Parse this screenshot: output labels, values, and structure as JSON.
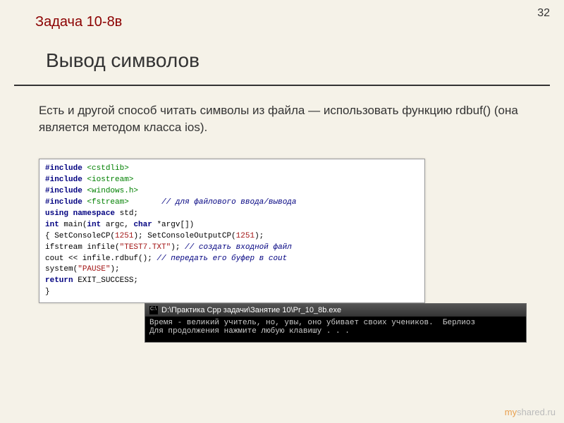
{
  "page_number": "32",
  "task_label": "Задача 10-8в",
  "title": "Вывод символов",
  "description": "Есть и другой способ читать символы из файла — использовать функцию rdbuf() (она является методом класса ios).",
  "code": {
    "inc1": "#include",
    "inc1h": "<cstdlib>",
    "inc2": "#include",
    "inc2h": "<iostream>",
    "inc3": "#include",
    "inc3h": "<windows.h>",
    "inc4": "#include",
    "inc4h": "<fstream>",
    "inc4c": "// для файлового ввода/вывода",
    "using": "using namespace",
    "std": " std;",
    "intmain": "int",
    "main_sig": " main(",
    "intarg": "int",
    "argrest": " argc, ",
    "chararg": "char",
    "argv": " *argv[])",
    "lbrace": "{",
    "setcp": "   SetConsoleCP(",
    "n1251a": "1251",
    "paren_semi": "); SetConsoleOutputCP(",
    "n1251b": "1251",
    "paren_end": ");",
    "ifstream": "   ifstream infile(",
    "test7": "\"TEST7.TXT\"",
    "close_if": ");",
    "cmt_create": " // создать входной файл",
    "cout": "   cout << infile.rdbuf();",
    "cmt_pass": "    // передать его буфер в cout",
    "system": "   system(",
    "pause": "\"PAUSE\"",
    "sys_end": ");",
    "return": "   return",
    "exit": " EXIT_SUCCESS;",
    "rbrace": "}"
  },
  "console": {
    "title": "D:\\Практика Cpp задачи\\Занятие 10\\Pr_10_8b.exe",
    "line1": "Время - великий учитель, но, увы, оно убивает своих учеников.  Берлиоз",
    "line2": "Для продолжения нажмите любую клавишу . . ."
  },
  "watermark_prefix": "my",
  "watermark_suffix": "shared.ru"
}
